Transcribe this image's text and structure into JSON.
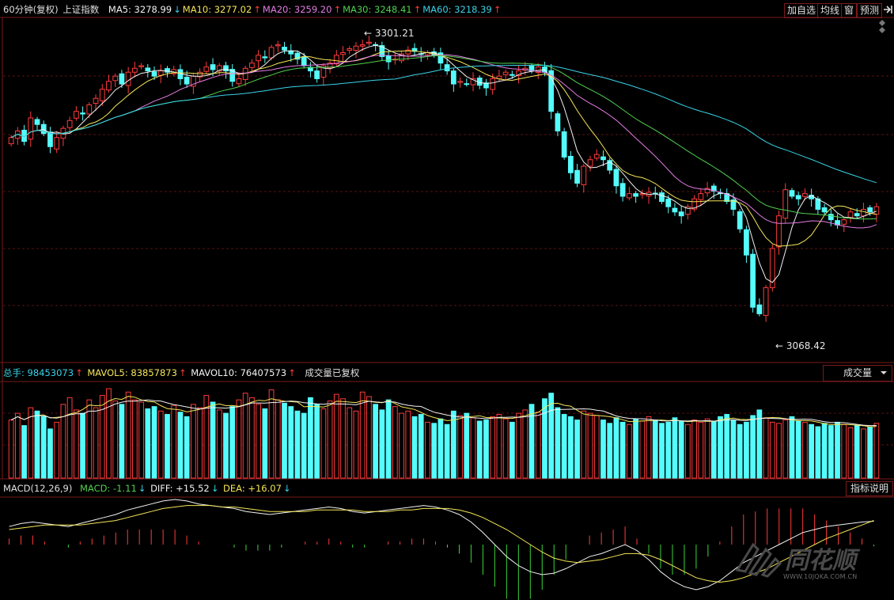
{
  "header": {
    "period": "60分钟(复权)",
    "index_name": "上证指数",
    "ma": [
      {
        "label": "MA5: 3278.99",
        "trend": "down",
        "color": "#f2f2f2"
      },
      {
        "label": "MA10: 3277.02",
        "trend": "up",
        "color": "#f5e657"
      },
      {
        "label": "MA20: 3259.20",
        "trend": "up",
        "color": "#e57be5"
      },
      {
        "label": "MA30: 3248.41",
        "trend": "up",
        "color": "#4fd14f"
      },
      {
        "label": "MA60: 3218.39",
        "trend": "up",
        "color": "#39d3e8"
      }
    ]
  },
  "toolbar": {
    "add_fav": "加自选",
    "ma_line": "均线",
    "window": "窗",
    "alert": "预测",
    "nav_icon": "arrow-right-icon"
  },
  "price_chart": {
    "high_label": "3301.21",
    "low_label": "3068.42",
    "colors": {
      "up": "#ff3b3b",
      "down": "#54fcfc"
    }
  },
  "volume_panel": {
    "total": "总手: 98453073",
    "total_trend": "up",
    "mavol5": "MAVOL5: 83857873",
    "mavol5_trend": "up",
    "mavol10": "MAVOL10: 76407573",
    "mavol10_trend": "up",
    "note": "成交量已复权",
    "selector": "成交量"
  },
  "macd_panel": {
    "title": "MACD(12,26,9)",
    "macd": "MACD: -1.11",
    "macd_trend": "down",
    "diff": "DIFF: +15.52",
    "diff_trend": "down",
    "dea": "DEA: +16.07",
    "dea_trend": "down",
    "help": "指标说明"
  },
  "watermark": {
    "brand": "同花顺",
    "url": "WWW.10JQKA.COM.CN"
  },
  "chart_data": {
    "type": "candlestick",
    "high": 3301.21,
    "low": 3068.42,
    "close_series": [
      3225,
      3230,
      3222,
      3240,
      3235,
      3228,
      3218,
      3225,
      3232,
      3238,
      3245,
      3243,
      3250,
      3255,
      3262,
      3268,
      3272,
      3266,
      3275,
      3278,
      3280,
      3276,
      3272,
      3276,
      3275,
      3277,
      3270,
      3266,
      3272,
      3275,
      3279,
      3277,
      3280,
      3276,
      3268,
      3270,
      3278,
      3282,
      3288,
      3286,
      3294,
      3296,
      3292,
      3289,
      3285,
      3280,
      3276,
      3270,
      3280,
      3282,
      3288,
      3290,
      3293,
      3295,
      3296,
      3298,
      3296,
      3287,
      3283,
      3285,
      3289,
      3292,
      3291,
      3289,
      3290,
      3288,
      3282,
      3276,
      3266,
      3268,
      3266,
      3270,
      3265,
      3263,
      3270,
      3272,
      3275,
      3273,
      3276,
      3278,
      3276,
      3279,
      3275,
      3245,
      3230,
      3210,
      3198,
      3190,
      3203,
      3208,
      3212,
      3208,
      3200,
      3188,
      3180,
      3182,
      3180,
      3182,
      3183,
      3182,
      3176,
      3172,
      3168,
      3165,
      3172,
      3178,
      3182,
      3186,
      3184,
      3182,
      3176,
      3170,
      3155,
      3135,
      3095,
      3090,
      3110,
      3140,
      3165,
      3185,
      3180,
      3178,
      3182,
      3178,
      3170,
      3168,
      3162,
      3158,
      3162,
      3168,
      3165,
      3170,
      3168,
      3172
    ],
    "volume_series": [
      52,
      58,
      47,
      63,
      60,
      55,
      44,
      50,
      66,
      72,
      61,
      58,
      70,
      63,
      74,
      80,
      69,
      66,
      77,
      70,
      68,
      62,
      64,
      60,
      57,
      65,
      59,
      55,
      66,
      63,
      74,
      68,
      61,
      58,
      64,
      70,
      76,
      72,
      66,
      62,
      79,
      70,
      67,
      64,
      60,
      58,
      72,
      66,
      62,
      69,
      75,
      71,
      63,
      60,
      77,
      73,
      66,
      61,
      70,
      64,
      58,
      60,
      55,
      57,
      50,
      49,
      53,
      48,
      60,
      56,
      58,
      54,
      51,
      52,
      55,
      57,
      53,
      50,
      58,
      61,
      66,
      59,
      71,
      76,
      63,
      57,
      55,
      52,
      60,
      58,
      56,
      52,
      49,
      54,
      50,
      48,
      53,
      51,
      55,
      52,
      49,
      50,
      54,
      51,
      48,
      52,
      50,
      53,
      51,
      55,
      57,
      52,
      48,
      50,
      56,
      61,
      54,
      50,
      49,
      52,
      55,
      51,
      50,
      48,
      46,
      49,
      47,
      50,
      48,
      45,
      47,
      44,
      46,
      49
    ],
    "macd_diff": [
      12,
      14,
      15,
      14,
      13,
      12,
      14,
      16,
      18,
      20,
      23,
      25,
      27,
      29,
      30,
      29,
      27,
      26,
      25,
      24,
      22,
      21,
      20,
      21,
      22,
      23,
      24,
      25,
      24,
      22,
      21,
      22,
      23,
      24,
      25,
      26,
      25,
      23,
      20,
      15,
      8,
      0,
      -8,
      -14,
      -18,
      -20,
      -19,
      -16,
      -12,
      -8,
      -6,
      -3,
      0,
      -4,
      -10,
      -18,
      -24,
      -28,
      -30,
      -28,
      -24,
      -18,
      -12,
      -8,
      -4,
      0,
      4,
      8,
      10,
      12,
      13,
      14,
      15,
      15.5
    ],
    "macd_dea": [
      10,
      11,
      12,
      13,
      13,
      13,
      13,
      14,
      15,
      16,
      18,
      20,
      22,
      24,
      25,
      26,
      26,
      26,
      25,
      25,
      24,
      23,
      22,
      22,
      22,
      22,
      23,
      23,
      23,
      23,
      22,
      22,
      22,
      23,
      23,
      24,
      24,
      24,
      23,
      21,
      18,
      14,
      10,
      5,
      0,
      -5,
      -9,
      -11,
      -12,
      -11,
      -10,
      -8,
      -6,
      -6,
      -7,
      -10,
      -14,
      -18,
      -22,
      -24,
      -25,
      -24,
      -22,
      -19,
      -16,
      -12,
      -8,
      -4,
      0,
      4,
      7,
      10,
      13,
      16.07
    ],
    "ma5_last": 3278.99,
    "ma10_last": 3277.02,
    "ma20_last": 3259.2,
    "ma30_last": 3248.41,
    "ma60_last": 3218.39,
    "total_volume": 98453073,
    "mavol5": 83857873,
    "mavol10": 76407573,
    "macd": -1.11,
    "diff": 15.52,
    "dea": 16.07
  }
}
